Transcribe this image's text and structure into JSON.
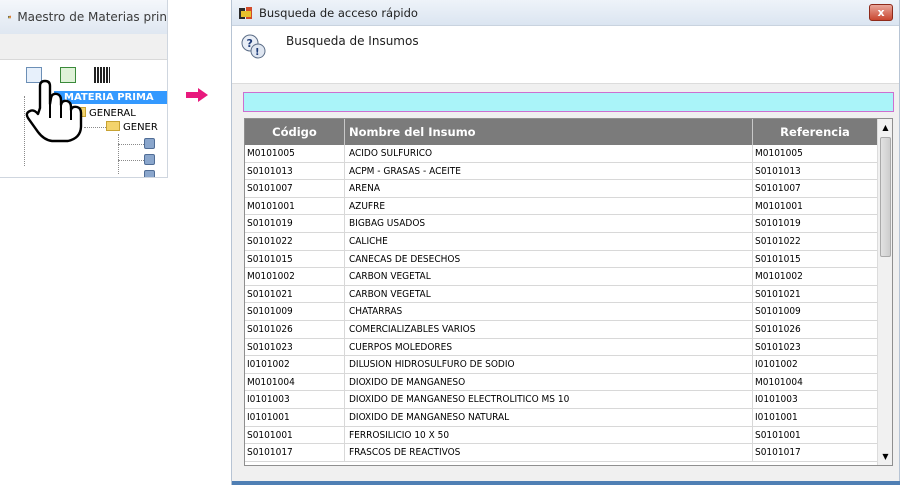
{
  "background_window": {
    "title": "Maestro de Materias prin",
    "tree": {
      "selected": "MATERIA PRIMA",
      "level1": "GENERAL",
      "level2": "GENER"
    }
  },
  "dialog": {
    "title": "Busqueda de acceso rápido",
    "close_label": "x",
    "header_text": "Busqueda de Insumos",
    "search_value": "",
    "columns": [
      "Código",
      "Nombre del Insumo",
      "Referencia"
    ],
    "rows": [
      [
        "M0101005",
        "ACIDO SULFURICO",
        "M0101005"
      ],
      [
        "S0101013",
        "ACPM - GRASAS - ACEITE",
        "S0101013"
      ],
      [
        "S0101007",
        "ARENA",
        "S0101007"
      ],
      [
        "M0101001",
        "AZUFRE",
        "M0101001"
      ],
      [
        "S0101019",
        "BIGBAG USADOS",
        "S0101019"
      ],
      [
        "S0101022",
        "CALICHE",
        "S0101022"
      ],
      [
        "S0101015",
        "CANECAS DE DESECHOS",
        "S0101015"
      ],
      [
        "M0101002",
        "CARBON VEGETAL",
        "M0101002"
      ],
      [
        "S0101021",
        "CARBON VEGETAL",
        "S0101021"
      ],
      [
        "S0101009",
        "CHATARRAS",
        "S0101009"
      ],
      [
        "S0101026",
        "COMERCIALIZABLES VARIOS",
        "S0101026"
      ],
      [
        "S0101023",
        "CUERPOS MOLEDORES",
        "S0101023"
      ],
      [
        "I0101002",
        "DILUSION HIDROSULFURO DE SODIO",
        "I0101002"
      ],
      [
        "M0101004",
        "DIOXIDO DE MANGANESO",
        "M0101004"
      ],
      [
        "I0101003",
        "DIOXIDO DE MANGANESO ELECTROLITICO MS 10",
        "I0101003"
      ],
      [
        "I0101001",
        "DIOXIDO DE MANGANESO NATURAL",
        "I0101001"
      ],
      [
        "S0101001",
        "FERROSILICIO 10 X 50",
        "S0101001"
      ],
      [
        "S0101017",
        "FRASCOS DE REACTIVOS",
        "S0101017"
      ]
    ]
  },
  "colors": {
    "search_bg": "#aaf4f9",
    "search_border": "#cd6fd0",
    "grid_header": "#7b7b7b",
    "tree_selection": "#3399ff",
    "arrow": "#e8197d"
  }
}
